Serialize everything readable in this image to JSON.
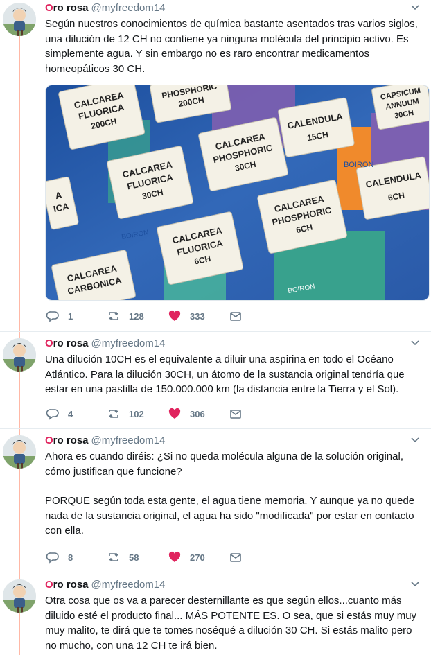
{
  "tweets": [
    {
      "name_first": "O",
      "name_rest": "ro rosa",
      "handle": "@myfreedom14",
      "paragraphs": [
        "Según nuestros conocimientos de química bastante asentados tras varios siglos, una dilución de 12 CH no contiene ya ninguna molécula del principio activo. Es simplemente agua. Y sin embargo no es raro encontrar medicamentos homeopáticos 30 CH."
      ],
      "replies": "1",
      "retweets": "128",
      "likes": "333"
    },
    {
      "name_first": "O",
      "name_rest": "ro rosa",
      "handle": "@myfreedom14",
      "paragraphs": [
        "Una dilución 10CH es el equivalente a diluir una aspirina en todo el Océano Atlántico. Para la dilución 30CH, un átomo de la sustancia original tendría que estar en una pastilla de 150.000.000 km (la distancia entre la Tierra y el Sol)."
      ],
      "replies": "4",
      "retweets": "102",
      "likes": "306"
    },
    {
      "name_first": "O",
      "name_rest": "ro rosa",
      "handle": "@myfreedom14",
      "paragraphs": [
        "Ahora es cuando diréis: ¿Si no queda molécula alguna de la solución original, cómo justifican que funcione?",
        "PORQUE según toda esta gente, el agua tiene memoria. Y aunque ya no quede nada de la sustancia original, el agua ha sido \"modificada\" por estar en contacto con ella."
      ],
      "replies": "8",
      "retweets": "58",
      "likes": "270"
    },
    {
      "name_first": "O",
      "name_rest": "ro rosa",
      "handle": "@myfreedom14",
      "paragraphs": [
        "Otra cosa que os va a parecer desternillante es que según ellos...cuanto más diluido esté el producto final... MÁS POTENTE ES. O sea, que si estás muy muy muy malito, te dirá que te tomes noséqué a dilución 30 CH. Si estás malito pero no mucho, con una 12 CH te irá bien."
      ]
    }
  ],
  "media": {
    "boxes": [
      {
        "line1": "CALCAREA",
        "line2": "FLUORICA",
        "line3": "200CH"
      },
      {
        "line1": "PHOSPHORIC",
        "line2": "200CH",
        "line3": ""
      },
      {
        "line1": "CALENDULA",
        "line2": "15CH",
        "line3": ""
      },
      {
        "line1": "CAPSICUM",
        "line2": "ANNUUM",
        "line3": "30CH"
      },
      {
        "line1": "CALCAREA",
        "line2": "PHOSPHORIC",
        "line3": "30CH"
      },
      {
        "line1": "CALCAREA",
        "line2": "FLUORICA",
        "line3": "30CH"
      },
      {
        "line1": "CALENDULA",
        "line2": "6CH",
        "line3": ""
      },
      {
        "line1": "CALCAREA",
        "line2": "PHOSPHORIC",
        "line3": "6CH"
      },
      {
        "line1": "CALCAREA",
        "line2": "FLUORICA",
        "line3": "6CH"
      },
      {
        "line1": "CALCAREA",
        "line2": "CARBONICA",
        "line3": ""
      },
      {
        "line1": "A",
        "line2": "ICA",
        "line3": ""
      }
    ],
    "brand": "BOIRON",
    "colors": {
      "blue": "#1d4f9e",
      "purple": "#8a5fb0",
      "orange": "#f08a2c",
      "green": "#3aa88a",
      "label": "#f4f1e6"
    }
  },
  "colors": {
    "thread_line": "#ffb8a6",
    "like_red": "#e0245e",
    "muted": "#657786"
  }
}
